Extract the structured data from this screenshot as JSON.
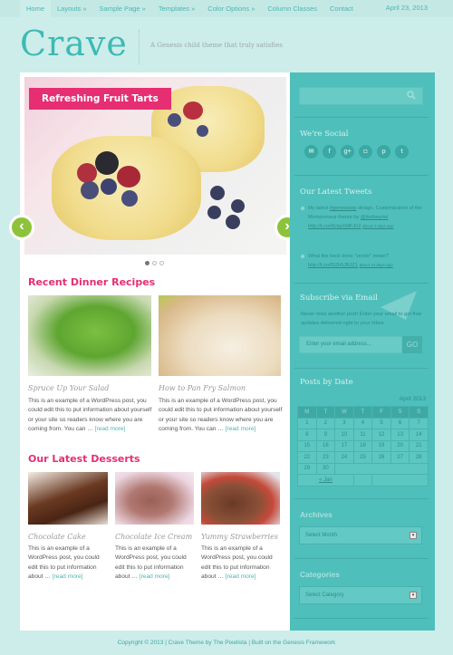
{
  "nav": {
    "items": [
      {
        "label": "Home",
        "active": true
      },
      {
        "label": "Layouts »"
      },
      {
        "label": "Sample Page »"
      },
      {
        "label": "Templates »"
      },
      {
        "label": "Color Options »"
      },
      {
        "label": "Column Classes"
      },
      {
        "label": "Contact"
      }
    ],
    "date": "April 23, 2013"
  },
  "header": {
    "site_title": "Crave",
    "tagline": "A Genesis child theme that truly satisfies"
  },
  "slider": {
    "caption": "Refreshing Fruit Tarts",
    "prev_icon": "‹",
    "next_icon": "›",
    "slide_count": 3,
    "active_slide": 1
  },
  "dinner": {
    "title": "Recent Dinner Recipes",
    "posts": [
      {
        "title": "Spruce Up Your Salad",
        "excerpt": "This is an example of a WordPress post, you could edit this to put information about yourself or your site so readers know where you are coming from. You can … ",
        "more": "[read more]"
      },
      {
        "title": "How to Pan Fry Salmon",
        "excerpt": "This is an example of a WordPress post, you could edit this to put information about yourself or your site so readers know where you are coming from. You can … ",
        "more": "[read more]"
      }
    ]
  },
  "desserts": {
    "title": "Our Latest Desserts",
    "posts": [
      {
        "title": "Chocolate Cake",
        "excerpt": "This is an example of a WordPress post, you could edit this to put information about … ",
        "more": "[read more]"
      },
      {
        "title": "Chocolate Ice Cream",
        "excerpt": "This is an example of a WordPress post, you could edit this to put information about … ",
        "more": "[read more]"
      },
      {
        "title": "Yummy Strawberries",
        "excerpt": "This is an example of a WordPress post, you could edit this to put information about … ",
        "more": "[read more]"
      }
    ]
  },
  "sidebar": {
    "search_placeholder": "",
    "social_title": "We're Social",
    "social_icons": [
      {
        "name": "email-icon",
        "glyph": "✉"
      },
      {
        "name": "facebook-icon",
        "glyph": "f"
      },
      {
        "name": "google-plus-icon",
        "glyph": "g+"
      },
      {
        "name": "instagram-icon",
        "glyph": "◘"
      },
      {
        "name": "pinterest-icon",
        "glyph": "p"
      },
      {
        "name": "twitter-icon",
        "glyph": "t"
      }
    ],
    "tweets_title": "Our Latest Tweets",
    "tweets": [
      {
        "text": "My latest ",
        "hashtag": "#genesiswp",
        "text2": " design. Customization of the Mompreneur theme by ",
        "mention": "@lindseyriel",
        "link": "http://t.co/dUxpXMFJn2",
        "ago": "about 2 days ago"
      },
      {
        "text": "What the heck does \"vector\" mean? ",
        "link": "http://t.co/fS2h5JBJZ1",
        "ago": "about 14 days ago"
      }
    ],
    "subscribe_title": "Subscribe via Email",
    "subscribe_text": "Never miss another post! Enter your email to get free updates delivered right to your inbox",
    "email_placeholder": "Enter your email address...",
    "go_label": "GO",
    "calendar_title": "Posts by Date",
    "calendar": {
      "caption": "April 2013",
      "days": [
        "M",
        "T",
        "W",
        "T",
        "F",
        "S",
        "S"
      ],
      "weeks": [
        [
          "1",
          "2",
          "3",
          "4",
          "5",
          "6",
          "7"
        ],
        [
          "8",
          "9",
          "10",
          "11",
          "12",
          "13",
          "14"
        ],
        [
          "15",
          "16",
          "17",
          "18",
          "19",
          "20",
          "21"
        ],
        [
          "22",
          "23",
          "24",
          "25",
          "26",
          "27",
          "28"
        ],
        [
          "29",
          "30",
          "",
          "",
          "",
          "",
          ""
        ]
      ],
      "prev_link": "« Jan"
    },
    "archives_title": "Archives",
    "archives_select": "Select Month",
    "categories_title": "Categories",
    "categories_select": "Select Category"
  },
  "footer": {
    "text": "Copyright © 2013 | Crave Theme by The Pixelista | Built on the Genesis Framework"
  }
}
